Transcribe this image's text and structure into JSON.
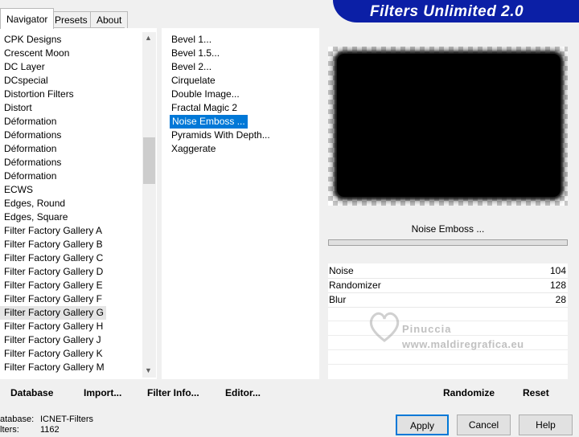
{
  "tabs": [
    {
      "label": "Navigator"
    },
    {
      "label": "Presets"
    },
    {
      "label": "About"
    }
  ],
  "banner": {
    "title": "Filters Unlimited 2.0"
  },
  "categories": [
    "CPK Designs",
    "Crescent Moon",
    "DC Layer",
    "DCspecial",
    "Distortion Filters",
    "Distort",
    "Déformation",
    "Déformations",
    "Déformation",
    "Déformations",
    "Déformation",
    "ECWS",
    "Edges, Round",
    "Edges, Square",
    "Filter Factory Gallery A",
    "Filter Factory Gallery B",
    "Filter Factory Gallery C",
    "Filter Factory Gallery D",
    "Filter Factory Gallery E",
    "Filter Factory Gallery F",
    "Filter Factory Gallery G",
    "Filter Factory Gallery H",
    "Filter Factory Gallery J",
    "Filter Factory Gallery K",
    "Filter Factory Gallery M"
  ],
  "selected_category": "Filter Factory Gallery G",
  "filters": [
    "Bevel 1...",
    "Bevel 1.5...",
    "Bevel 2...",
    "Cirquelate",
    "Double Image...",
    "Fractal Magic 2",
    "Noise Emboss ...",
    "Pyramids With Depth...",
    "Xaggerate"
  ],
  "selected_filter": "Noise Emboss ...",
  "filter_name": "Noise Emboss ...",
  "params": [
    {
      "label": "Noise",
      "value": "104"
    },
    {
      "label": "Randomizer",
      "value": "128"
    },
    {
      "label": "Blur",
      "value": "28"
    }
  ],
  "toolbar": {
    "database": "Database",
    "import": "Import...",
    "filter_info": "Filter Info...",
    "editor": "Editor...",
    "randomize": "Randomize",
    "reset": "Reset"
  },
  "status": {
    "database_label": "atabase:",
    "database_value": "ICNET-Filters",
    "filters_label": "lters:",
    "filters_value": "1162"
  },
  "buttons": {
    "apply": "Apply",
    "cancel": "Cancel",
    "help": "Help"
  },
  "watermark": {
    "line1": "Pinuccia",
    "line2": "www.maldiregrafica.eu"
  },
  "colors": {
    "banner": "#0b1fa6",
    "selection": "#0078d7",
    "preview_frame": "#000000"
  }
}
